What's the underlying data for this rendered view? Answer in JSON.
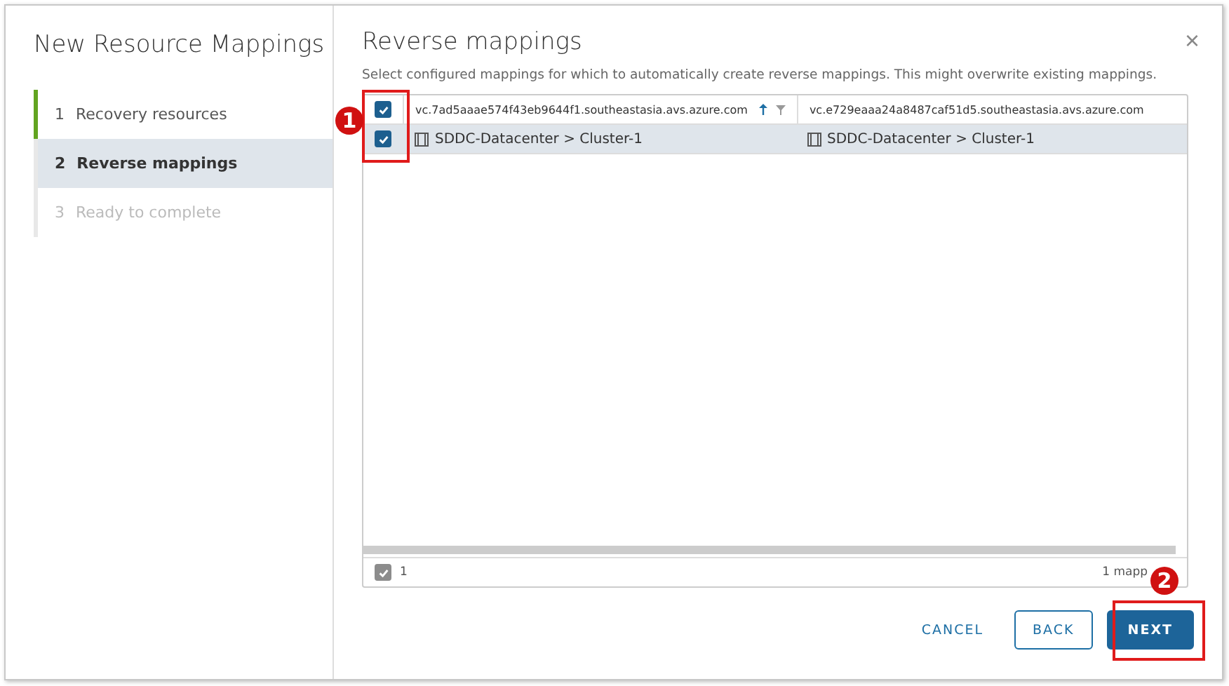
{
  "wizard": {
    "title": "New Resource Mappings",
    "steps": [
      {
        "number": "1",
        "label": "Recovery resources",
        "completed": true,
        "disabled": false,
        "selected": false
      },
      {
        "number": "2",
        "label": "Reverse mappings",
        "completed": false,
        "disabled": false,
        "selected": true
      },
      {
        "number": "3",
        "label": "Ready to complete",
        "completed": false,
        "disabled": true,
        "selected": false
      }
    ]
  },
  "page": {
    "title": "Reverse mappings",
    "close": "×",
    "description": "Select configured mappings for which to automatically create reverse mappings. This might overwrite existing mappings."
  },
  "table": {
    "select_all": {
      "checked": true
    },
    "columns": [
      "vc.7ad5aaae574f43eb9644f1.southeastasia.avs.azure.com",
      "vc.e729eaaa24a8487caf51d5.southeastasia.avs.azure.com"
    ],
    "rows": [
      {
        "selected": true,
        "cells": [
          "SDDC-Datacenter > Cluster-1",
          "SDDC-Datacenter > Cluster-1"
        ]
      }
    ],
    "footer": {
      "selected_count": "1",
      "total": "1 mapp"
    }
  },
  "buttons": [
    {
      "label": "CANCEL",
      "kind": "flat"
    },
    {
      "label": "BACK",
      "kind": "outline"
    },
    {
      "label": "NEXT",
      "kind": "primary"
    }
  ],
  "callouts": [
    {
      "number": "1",
      "kind": "checkboxes"
    },
    {
      "number": "2",
      "kind": "next"
    }
  ]
}
